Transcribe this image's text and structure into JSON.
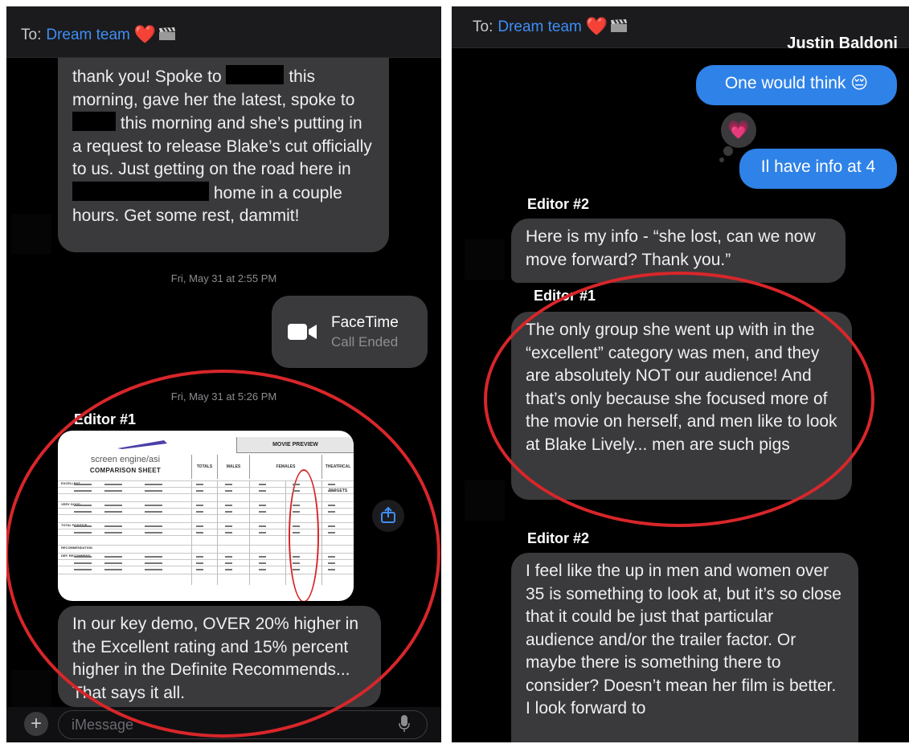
{
  "left": {
    "header": {
      "prefix": "To:",
      "recipient": "Dream team",
      "heart": "❤️"
    },
    "msg1": {
      "seg1": "thank you! Spoke to",
      "seg2": "this morning, gave her the latest, spoke to",
      "seg3": "this morning and she’s putting in a request to release Blake’s cut officially to us. Just getting on the road here in",
      "seg4": "home in a couple hours. Get some rest, dammit!"
    },
    "timestamp1": "Fri, May 31 at 2:55 PM",
    "facetime": {
      "title": "FaceTime",
      "subtitle": "Call Ended",
      "icon": "video-camera-icon"
    },
    "timestamp2": "Fri, May 31 at 5:26 PM",
    "sender": "Editor #1",
    "attachment": {
      "logo": "screen engine/asi",
      "sheet_title": "COMPARISON SHEET",
      "header_movie": "MOVIE PREVIEW",
      "columns": [
        "TOTALS",
        "MALES",
        "FEMALES",
        "THEATRICAL TARGETS"
      ],
      "sections": [
        "EXCELLENT",
        "VERY GOOD",
        "TOTAL POSITIVE",
        "RECOMMENDATION",
        "DEF. RECOMMEND"
      ]
    },
    "msg2": "In our key demo, OVER 20% higher in the Excellent rating and 15% percent higher in the Definite Recommends... That says it all.",
    "input": {
      "placeholder": "iMessage"
    }
  },
  "right": {
    "header": {
      "prefix": "To:",
      "recipient": "Dream team",
      "heart": "❤️"
    },
    "contact_name": "Justin Baldoni",
    "sent1": "One would think 😔",
    "tapback": "💗",
    "sent2": "Il have info at 4",
    "sender_a": "Editor #2",
    "msg_a": "Here is my info - “she lost, can we now move forward? Thank you.”",
    "sender_b": "Editor #1",
    "msg_b": "The only group she went up with in the “excellent” category was men, and they are absolutely NOT our audience! And that’s only because she focused more of the movie on herself, and men like to look at Blake Lively... men are such pigs",
    "sender_c": "Editor #2",
    "msg_c": "I feel like the up in men and women over 35 is something to look at, but it’s so close that it could be just that particular audience and/or the trailer factor. Or maybe there is something there to consider?  Doesn’t mean her film is better. I look forward to"
  },
  "colors": {
    "sent_bubble": "#2f82e7",
    "received_bubble": "#3a3a3c",
    "annotation_red": "#d8262a",
    "link_blue": "#3e8ef7"
  }
}
